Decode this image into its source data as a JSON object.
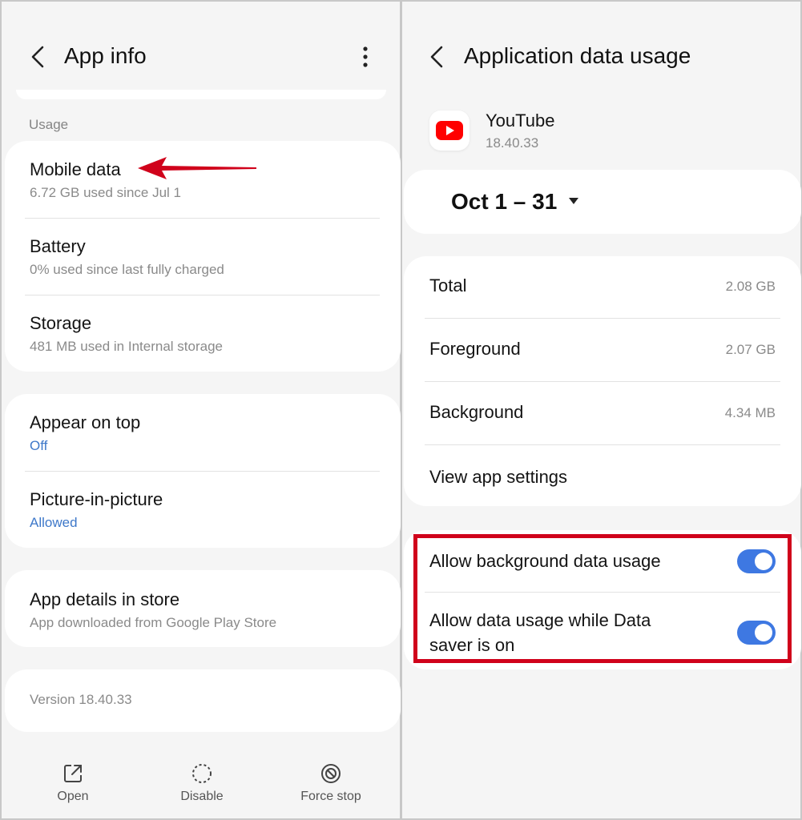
{
  "left": {
    "header": {
      "title": "App info"
    },
    "usage_section_label": "Usage",
    "usage_items": [
      {
        "title": "Mobile data",
        "sub": "6.72 GB used since Jul 1"
      },
      {
        "title": "Battery",
        "sub": "0% used since last fully charged"
      },
      {
        "title": "Storage",
        "sub": "481 MB used in Internal storage"
      }
    ],
    "appear_on_top": {
      "title": "Appear on top",
      "sub": "Off"
    },
    "pip": {
      "title": "Picture-in-picture",
      "sub": "Allowed"
    },
    "store": {
      "title": "App details in store",
      "sub": "App downloaded from Google Play Store"
    },
    "version": "Version 18.40.33",
    "bottom_actions": [
      {
        "label": "Open",
        "icon": "open-external-icon"
      },
      {
        "label": "Disable",
        "icon": "disable-dashed-circle-icon"
      },
      {
        "label": "Force stop",
        "icon": "force-stop-icon"
      }
    ]
  },
  "right": {
    "header": {
      "title": "Application data usage"
    },
    "app": {
      "name": "YouTube",
      "version": "18.40.33",
      "icon": "youtube-logo-icon"
    },
    "date_range": "Oct 1 – 31",
    "stats": [
      {
        "label": "Total",
        "value": "2.08 GB"
      },
      {
        "label": "Foreground",
        "value": "2.07 GB"
      },
      {
        "label": "Background",
        "value": "4.34 MB"
      }
    ],
    "view_settings": "View app settings",
    "toggles": [
      {
        "label": "Allow background data usage",
        "on": true
      },
      {
        "label_line1": "Allow data usage while Data",
        "label_line2": "saver is on",
        "on": true
      }
    ]
  },
  "colors": {
    "accent_blue": "#3e78e2",
    "annotation_red": "#d0021b",
    "youtube_red": "#ff0000"
  }
}
